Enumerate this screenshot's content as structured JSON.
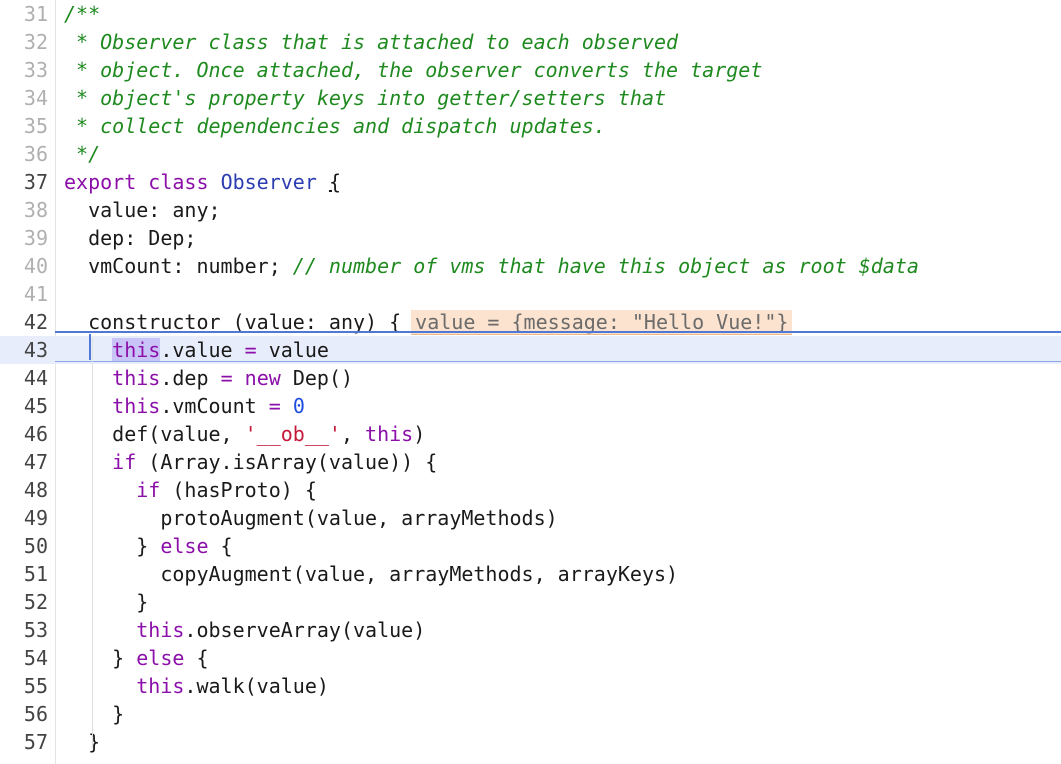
{
  "editor": {
    "lines": [
      {
        "num": "31",
        "tokens": [
          {
            "t": "/**",
            "k": "comment"
          }
        ]
      },
      {
        "num": "32",
        "tokens": [
          {
            "t": " * Observer class that is attached to each observed",
            "k": "comment"
          }
        ]
      },
      {
        "num": "33",
        "tokens": [
          {
            "t": " * object. Once attached, the observer converts the target",
            "k": "comment"
          }
        ]
      },
      {
        "num": "34",
        "tokens": [
          {
            "t": " * object's property keys into getter/setters that",
            "k": "comment"
          }
        ]
      },
      {
        "num": "35",
        "tokens": [
          {
            "t": " * collect dependencies and dispatch updates.",
            "k": "comment"
          }
        ]
      },
      {
        "num": "36",
        "tokens": [
          {
            "t": " */",
            "k": "comment"
          }
        ]
      },
      {
        "num": "37",
        "active": true,
        "tokens": [
          {
            "t": "export",
            "k": "kw"
          },
          {
            "t": " "
          },
          {
            "t": "class",
            "k": "kw"
          },
          {
            "t": " "
          },
          {
            "t": "Observer",
            "k": "cls"
          },
          {
            "t": " "
          },
          {
            "t": "{",
            "k": "brace"
          }
        ]
      },
      {
        "num": "38",
        "tokens": [
          {
            "t": "  value: any;"
          }
        ]
      },
      {
        "num": "39",
        "tokens": [
          {
            "t": "  dep: Dep;"
          }
        ]
      },
      {
        "num": "40",
        "tokens": [
          {
            "t": "  vmCount: number; "
          },
          {
            "t": "// number of vms that have this object as root $data",
            "k": "comment"
          }
        ]
      },
      {
        "num": "41",
        "tokens": []
      },
      {
        "num": "42",
        "active": true,
        "tokens": [
          {
            "t": "  constructor (value: any) {"
          },
          {
            "t": "value = {message: \"Hello Vue!\"}",
            "k": "inline"
          }
        ]
      },
      {
        "num": "43",
        "active": true,
        "current": true,
        "tokens": [
          {
            "t": "    "
          },
          {
            "t": "this",
            "k": "thissel"
          },
          {
            "t": ".value "
          },
          {
            "t": "=",
            "k": "op"
          },
          {
            "t": " value"
          }
        ]
      },
      {
        "num": "44",
        "active": true,
        "tokens": [
          {
            "t": "    "
          },
          {
            "t": "this",
            "k": "kw"
          },
          {
            "t": ".dep "
          },
          {
            "t": "=",
            "k": "op"
          },
          {
            "t": " "
          },
          {
            "t": "new",
            "k": "kw"
          },
          {
            "t": " Dep()"
          }
        ]
      },
      {
        "num": "45",
        "active": true,
        "tokens": [
          {
            "t": "    "
          },
          {
            "t": "this",
            "k": "kw"
          },
          {
            "t": ".vmCount "
          },
          {
            "t": "=",
            "k": "op"
          },
          {
            "t": " "
          },
          {
            "t": "0",
            "k": "num"
          }
        ]
      },
      {
        "num": "46",
        "active": true,
        "tokens": [
          {
            "t": "    def(value, "
          },
          {
            "t": "'__ob__'",
            "k": "str"
          },
          {
            "t": ", "
          },
          {
            "t": "this",
            "k": "kw"
          },
          {
            "t": ")"
          }
        ]
      },
      {
        "num": "47",
        "active": true,
        "tokens": [
          {
            "t": "    "
          },
          {
            "t": "if",
            "k": "kw"
          },
          {
            "t": " (Array.isArray(value)) {"
          }
        ]
      },
      {
        "num": "48",
        "active": true,
        "tokens": [
          {
            "t": "      "
          },
          {
            "t": "if",
            "k": "kw"
          },
          {
            "t": " (hasProto) {"
          }
        ]
      },
      {
        "num": "49",
        "active": true,
        "tokens": [
          {
            "t": "        protoAugment(value, arrayMethods)"
          }
        ]
      },
      {
        "num": "50",
        "active": true,
        "tokens": [
          {
            "t": "      } "
          },
          {
            "t": "else",
            "k": "kw"
          },
          {
            "t": " {"
          }
        ]
      },
      {
        "num": "51",
        "active": true,
        "tokens": [
          {
            "t": "        copyAugment(value, arrayMethods, arrayKeys)"
          }
        ]
      },
      {
        "num": "52",
        "active": true,
        "tokens": [
          {
            "t": "      }"
          }
        ]
      },
      {
        "num": "53",
        "active": true,
        "tokens": [
          {
            "t": "      "
          },
          {
            "t": "this",
            "k": "kw"
          },
          {
            "t": ".observeArray(value)"
          }
        ]
      },
      {
        "num": "54",
        "active": true,
        "tokens": [
          {
            "t": "    } "
          },
          {
            "t": "else",
            "k": "kw"
          },
          {
            "t": " {"
          }
        ]
      },
      {
        "num": "55",
        "active": true,
        "tokens": [
          {
            "t": "      "
          },
          {
            "t": "this",
            "k": "kw"
          },
          {
            "t": ".walk(value)"
          }
        ]
      },
      {
        "num": "56",
        "active": true,
        "tokens": [
          {
            "t": "    }"
          }
        ]
      },
      {
        "num": "57",
        "active": true,
        "tokens": [
          {
            "t": "  }"
          }
        ]
      }
    ]
  }
}
